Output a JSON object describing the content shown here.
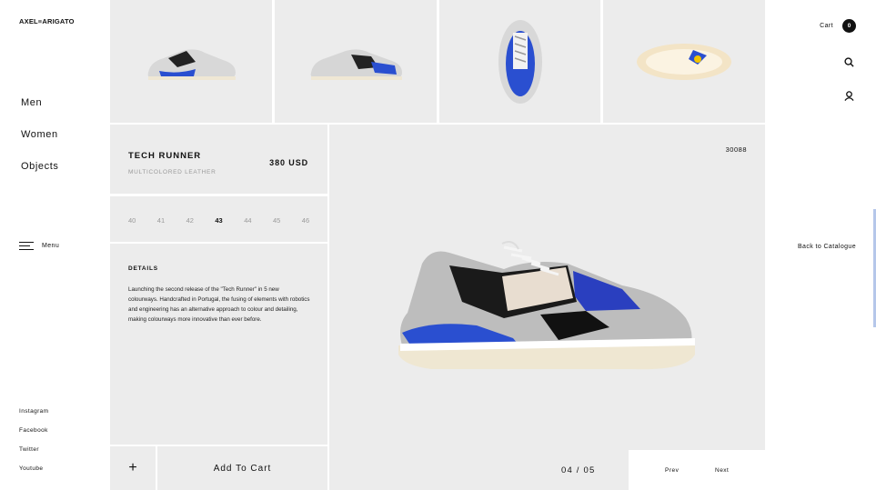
{
  "brand": {
    "logo": "AXEL≡ARIGATO"
  },
  "nav": {
    "items": [
      "Men",
      "Women",
      "Objects"
    ],
    "menu_label": "Menu"
  },
  "social": [
    "Instagram",
    "Facebook",
    "Twitter",
    "Youtube"
  ],
  "header": {
    "cart_label": "Cart",
    "cart_count": "0",
    "icons": [
      "search-icon",
      "user-icon"
    ]
  },
  "thumbnails": [
    {
      "alt": "sneaker-side-view"
    },
    {
      "alt": "sneaker-side-view-alt"
    },
    {
      "alt": "sneaker-top-view"
    },
    {
      "alt": "sneaker-sole-view"
    }
  ],
  "product": {
    "name": "TECH RUNNER",
    "material": "MULTICOLORED LEATHER",
    "price": "380 USD",
    "sku": "30088",
    "sizes": [
      "40",
      "41",
      "42",
      "43",
      "44",
      "45",
      "46"
    ],
    "selected_size": "43",
    "details_heading": "DETAILS",
    "details_text": "Launching the second release of the \"Tech Runner\" in 5 new colourways. Handcrafted in Portugal, the fusing of elements with robotics and engineering has an alternative approach to colour and detailing, making colourways more innovative than ever before."
  },
  "actions": {
    "plus": "+",
    "add_to_cart": "Add To Cart",
    "back": "Back to Catalogue"
  },
  "pager": {
    "counter": "04 / 05",
    "prev": "Prev",
    "next": "Next"
  },
  "colors": {
    "panel_bg": "#ececec",
    "accent_blue": "#2a4fd0",
    "text": "#111111",
    "muted": "#9a9a9a"
  }
}
